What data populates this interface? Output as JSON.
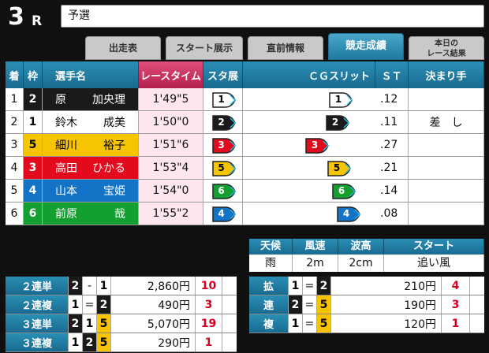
{
  "header": {
    "race_number": "3",
    "race_unit": "R",
    "race_name": "予選"
  },
  "tabs": [
    {
      "label": "出走表"
    },
    {
      "label": "スタート展示"
    },
    {
      "label": "直前情報"
    },
    {
      "label": "競走成績"
    },
    {
      "label1": "本日の",
      "label2": "レース結果"
    }
  ],
  "columns": [
    "着",
    "枠",
    "選手名",
    "レースタイム",
    "スタ展",
    "ＣＧスリット",
    "ＳＴ",
    "決まり手"
  ],
  "rows": [
    {
      "pos": "1",
      "waku": "2",
      "sei": "原",
      "mei": "加央理",
      "time": "1'49\"5",
      "tenji": "1",
      "cg": "1",
      "st": ".12",
      "kimarite": ""
    },
    {
      "pos": "2",
      "waku": "1",
      "sei": "鈴木",
      "mei": "成美",
      "time": "1'50\"0",
      "tenji": "2",
      "cg": "2",
      "st": ".11",
      "kimarite": "差　し"
    },
    {
      "pos": "3",
      "waku": "5",
      "sei": "細川",
      "mei": "裕子",
      "time": "1'51\"6",
      "tenji": "3",
      "cg": "3",
      "st": ".27",
      "kimarite": ""
    },
    {
      "pos": "4",
      "waku": "3",
      "sei": "高田",
      "mei": "ひかる",
      "time": "1'53\"4",
      "tenji": "5",
      "cg": "5",
      "st": ".21",
      "kimarite": ""
    },
    {
      "pos": "5",
      "waku": "4",
      "sei": "山本",
      "mei": "宝姫",
      "time": "1'54\"0",
      "tenji": "6",
      "cg": "6",
      "st": ".14",
      "kimarite": ""
    },
    {
      "pos": "6",
      "waku": "6",
      "sei": "前原",
      "mei": "哉",
      "time": "1'55\"2",
      "tenji": "4",
      "cg": "4",
      "st": ".08",
      "kimarite": ""
    }
  ],
  "weather": {
    "headers": [
      "天候",
      "風速",
      "波高",
      "スタート"
    ],
    "values": [
      "雨",
      "2m",
      "2cm",
      "追い風"
    ]
  },
  "payouts": [
    {
      "label": "２連単",
      "n1": "2",
      "s1": "-",
      "n2": "1",
      "n3": "",
      "amount": "2,860円",
      "pop": "10"
    },
    {
      "label": "２連複",
      "n1": "1",
      "s1": "=",
      "n2": "2",
      "n3": "",
      "amount": "490円",
      "pop": "3"
    },
    {
      "label": "３連単",
      "n1": "2",
      "s1": "1",
      "n2": "5",
      "n3": "",
      "amount": "5,070円",
      "pop": "19"
    },
    {
      "label": "３連複",
      "n1": "1",
      "s1": "2",
      "n2": "5",
      "n3": "",
      "amount": "290円",
      "pop": "1"
    }
  ],
  "kakuren": {
    "labels": [
      "拡",
      "連",
      "複"
    ],
    "rows": [
      {
        "n1": "1",
        "sep": "=",
        "n2": "2",
        "amount": "210円",
        "pop": "4"
      },
      {
        "n1": "2",
        "sep": "=",
        "n2": "5",
        "amount": "190円",
        "pop": "3"
      },
      {
        "n1": "1",
        "sep": "=",
        "n2": "5",
        "amount": "120円",
        "pop": "1"
      }
    ]
  },
  "waku_colors": {
    "1": "#ffffff",
    "2": "#1a1a1a",
    "3": "#e20a1c",
    "4": "#1273c7",
    "5": "#f7c400",
    "6": "#14a030"
  }
}
